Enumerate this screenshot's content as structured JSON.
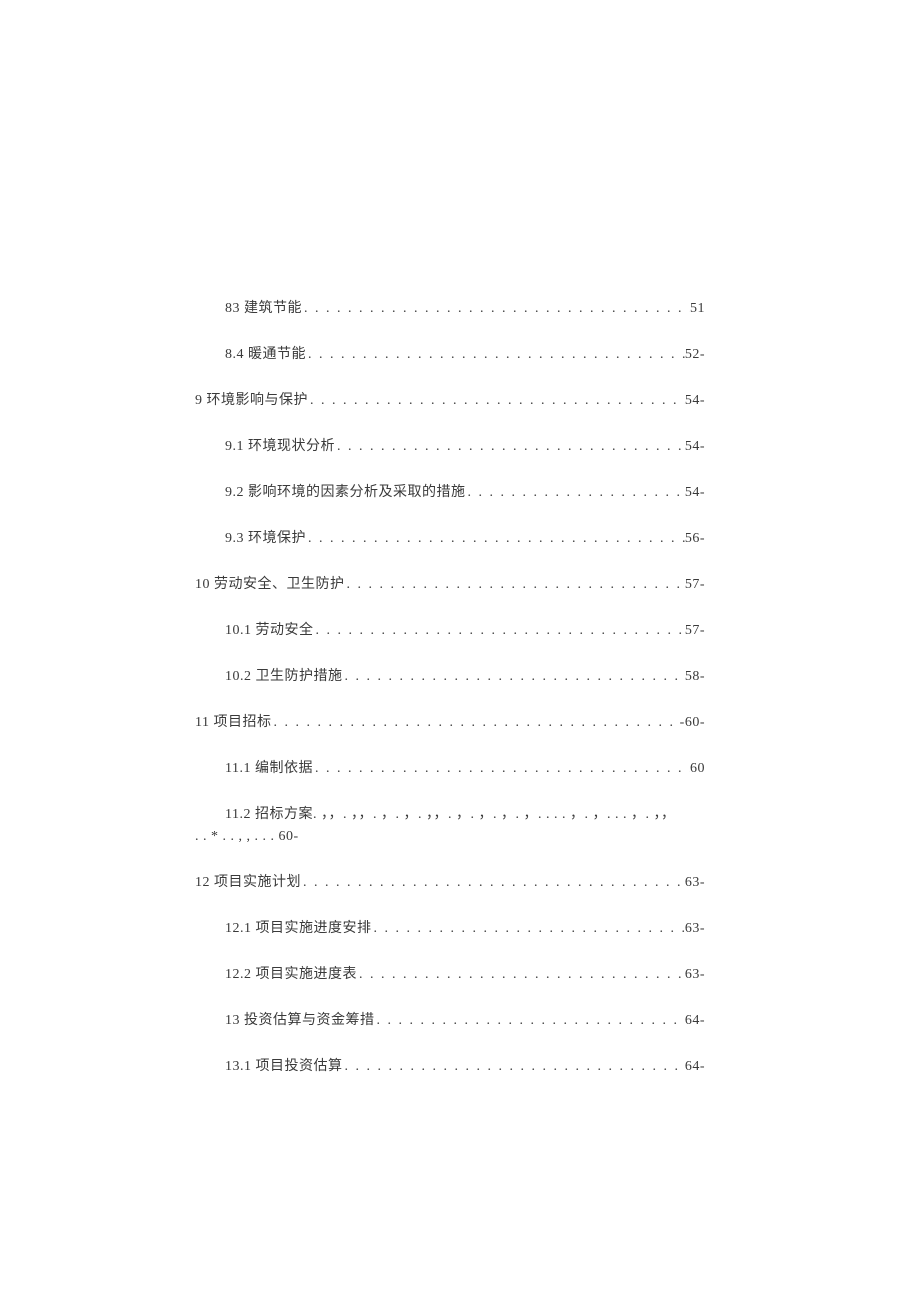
{
  "toc": [
    {
      "indent": 1,
      "label": "83 建筑节能",
      "page": "51",
      "dots": ". . . . . . . . . . . . . . . . . . . . . . . . . . . . . . . . . . . . . . . . . . . . . . . . . ."
    },
    {
      "indent": 1,
      "label": "8.4 暖通节能",
      "page": "52-",
      "dots": ". . . . . . . . . . . . . . . . . . . . . . . . . . . . . . . . . . . . . . . . . . . . . . . ."
    },
    {
      "indent": 0,
      "label": "9 环境影响与保护",
      "page": "54-",
      "dots": ". . . . . . . . . . . . . . . . . . . . . . . . . . . . . . . . . . . . . . . . . . . . . . ."
    },
    {
      "indent": 1,
      "label": "9.1 环境现状分析 ",
      "page": " 54-",
      "dots": ". . . . . . . . . . . . . . . . . . . . . . . . . . . . . . . . . . . . . . . . . . . ."
    },
    {
      "indent": 1,
      "label": "9.2 影响环境的因素分析及采取的措施 ",
      "page": " 54-",
      "dots": ". . . . . . . . . . . . . . . . . . . . . . . . . ."
    },
    {
      "indent": 1,
      "label": "9.3 环境保护 ",
      "page": " 56-",
      "dots": ". . . . . . . . . . . . . . . . . . . . . . . . . . . . . . . . . . . . . . . . . . . . . . . ."
    },
    {
      "indent": 0,
      "label": "10 劳动安全、卫生防护",
      "page": "57-",
      "dots": ". . . . . . . . . . . . . . . . . . . . . . . . . . . . . . . . . . . . . . . . ."
    },
    {
      "indent": 1,
      "label": "10.1 劳动安全",
      "page": "57-",
      "dots": ". . . . . . . . . . . . . . . . . . . . . . . . . . . . . . . . . . . . . . . . . . . . . . ."
    },
    {
      "indent": 1,
      "label": "10.2 卫生防护措施 ",
      "page": " 58-",
      "dots": ". . . . . . . . . . . . . . . . . . . . . . . . . . . . . . . . . . . . . . . . . ."
    },
    {
      "indent": 0,
      "label": "11 项目招标",
      "page": "-60-",
      "dots": ". . . . . . . . . . . . . . . . . . . . . . . . . . . . . . . . . . . . . . . . . . . . . . . . . . ."
    },
    {
      "indent": 1,
      "label": "11.1 编制依据 ",
      "page": " 60",
      "dots": ". . . . . . . . . . . . . . . . . . . . . . . . . . . . . . . . . . . . . . . . . . . . . . ."
    },
    {
      "indent": 1,
      "special": true,
      "line1": "11.2 招标方案. ，，. ，，. ，. ，. ，，. ，. ，. ，. ，. . . . ，. ，. . . ，. ，，",
      "line2": ". . * . . , , . . . 60-"
    },
    {
      "indent": 0,
      "label": "12 项目实施计划",
      "page": "63-",
      "dots": ". . . . . . . . . . . . . . . . . . . . . . . . . . . . . . . . . . . . . . . . . . . . . . . ."
    },
    {
      "indent": 1,
      "label": "12.1 项目实施进度安排 ",
      "page": " 63-",
      "dots": ". . . . . . . . . . . . . . . . . . . . . . . . . . . . . . . . . . . . . ."
    },
    {
      "indent": 1,
      "label": "12.2 项目实施进度表 ",
      "page": " 63-",
      "dots": ". . . . . . . . . . . . . . . . . . . . . . . . . . . . . . . . . . . . . . . ."
    },
    {
      "indent": 1,
      "label": "13 投资估算与资金筹措",
      "page": "64-",
      "dots": ". . . . . . . . . . . . . . . . . . . . . . . . . . . . . . . . . . . . . . . . ."
    },
    {
      "indent": 1,
      "label": "13.1 项目投资估算 ",
      "page": " 64-",
      "dots": ". . . . . . . . . . . . . . . . . . . . . . . . . . . . . . . . . . . . . . . . . ."
    }
  ]
}
